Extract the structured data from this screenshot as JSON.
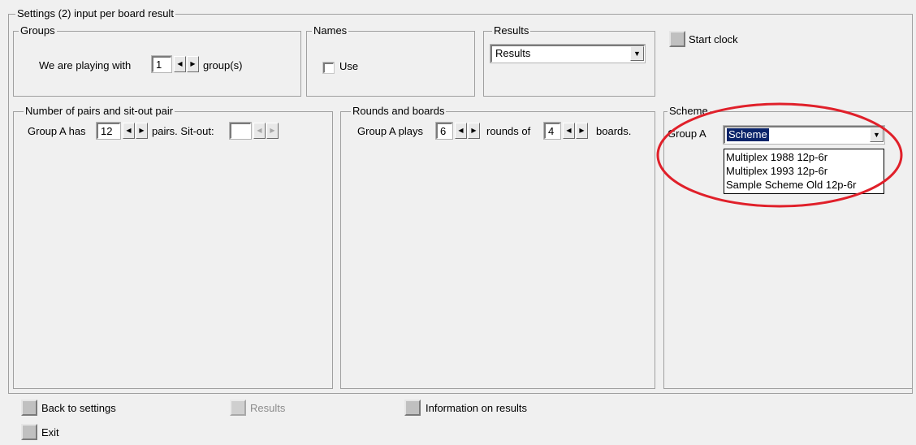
{
  "outer_group": {
    "title": "Settings (2)  input per board result"
  },
  "groups": {
    "title": "Groups",
    "prefix": "We are playing with",
    "value": "1",
    "suffix": "group(s)"
  },
  "names": {
    "title": "Names",
    "use_label": "Use"
  },
  "results_box": {
    "title": "Results",
    "selected": "Results"
  },
  "start_clock": {
    "label": "Start clock"
  },
  "pairs": {
    "title": "Number of pairs and sit-out pair",
    "prefix": "Group A has",
    "value": "12",
    "middle": "pairs. Sit-out:",
    "sitout_value": ""
  },
  "rounds": {
    "title": "Rounds and boards",
    "prefix": "Group A plays",
    "rounds_value": "6",
    "middle": "rounds of",
    "boards_value": "4",
    "suffix": "boards."
  },
  "scheme": {
    "title": "Scheme",
    "group_label": "Group A",
    "selected": "Scheme",
    "options": [
      "Multiplex 1988 12p-6r",
      "Multiplex 1993 12p-6r",
      "Sample Scheme Old 12p-6r"
    ]
  },
  "bottom": {
    "back_label": "Back to settings",
    "results_label": "Results",
    "info_label": "Information on results",
    "exit_label": "Exit"
  },
  "annotation_color": "#e0202a"
}
